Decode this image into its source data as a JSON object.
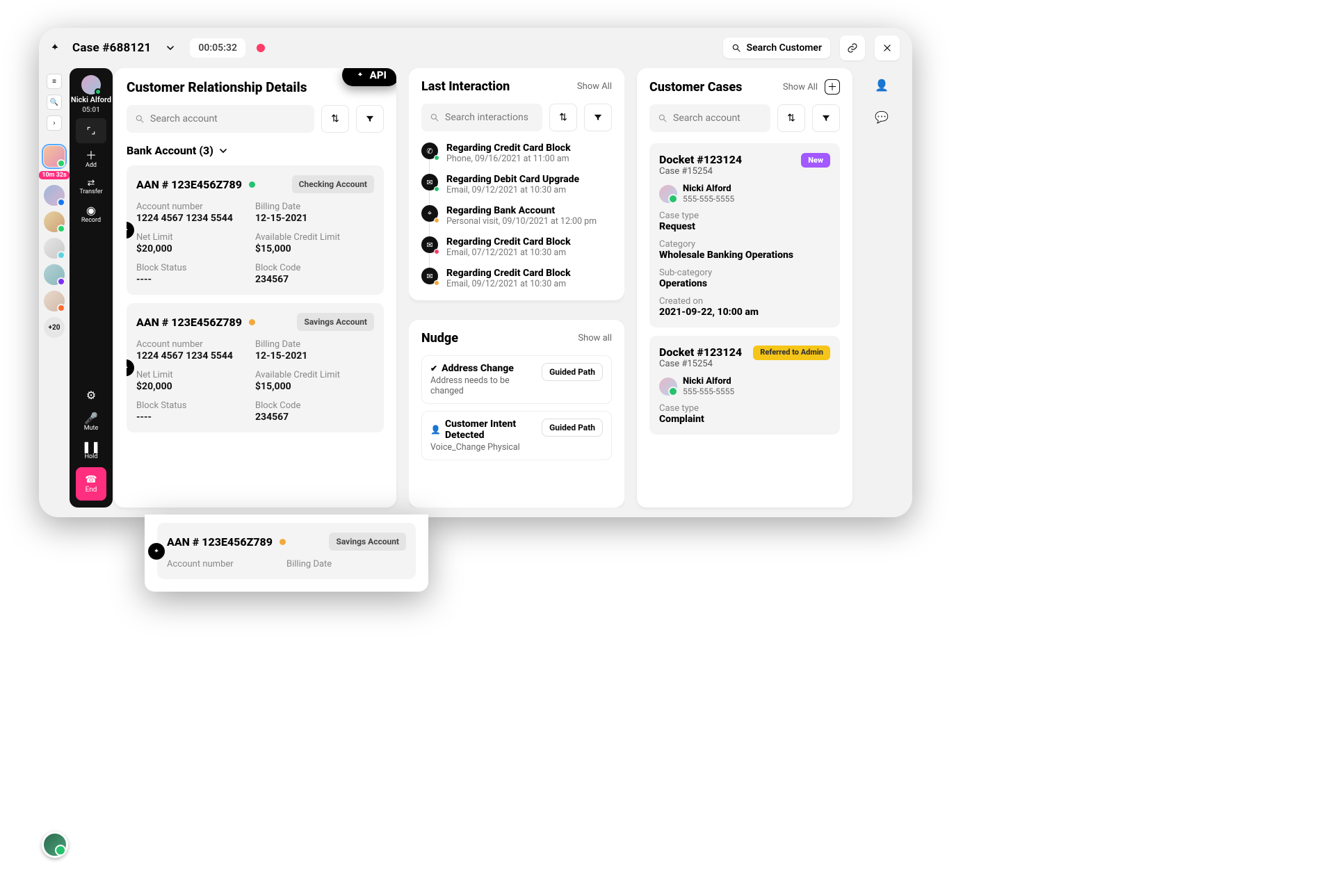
{
  "header": {
    "case_title": "Case #688121",
    "timer": "00:05:32",
    "search_label": "Search Customer"
  },
  "call_dock": {
    "name": "Nicki Alford",
    "timer": "05:01",
    "add": "Add",
    "transfer": "Transfer",
    "record": "Record",
    "mute": "Mute",
    "hold": "Hold",
    "end": "End"
  },
  "rail": {
    "active_label": "10m 32s",
    "more": "+20"
  },
  "crd": {
    "title": "Customer Relationship Details",
    "search_placeholder": "Search account",
    "api_label": "API",
    "section_title": "Bank Account (3)",
    "accounts": [
      {
        "aan": "AAN # 123E456Z789",
        "tag": "Checking Account",
        "status_color": "#25c26e",
        "account_number_label": "Account number",
        "account_number": "1224 4567 1234 5544",
        "billing_date_label": "Billing Date",
        "billing_date": "12-15-2021",
        "net_limit_label": "Net Limit",
        "net_limit": "$20,000",
        "avail_label": "Available Credit Limit",
        "avail": "$15,000",
        "block_status_label": "Block Status",
        "block_status": "----",
        "block_code_label": "Block Code",
        "block_code": "234567"
      },
      {
        "aan": "AAN # 123E456Z789",
        "tag": "Savings Account",
        "status_color": "#f2a93b",
        "account_number_label": "Account number",
        "account_number": "1224 4567 1234 5544",
        "billing_date_label": "Billing Date",
        "billing_date": "12-15-2021",
        "net_limit_label": "Net Limit",
        "net_limit": "$20,000",
        "avail_label": "Available Credit Limit",
        "avail": "$15,000",
        "block_status_label": "Block Status",
        "block_status": "----",
        "block_code_label": "Block Code",
        "block_code": "234567"
      },
      {
        "aan": "AAN # 123E456Z789",
        "tag": "Savings Account",
        "status_color": "#f2a93b",
        "account_number_label": "Account number",
        "account_number": "",
        "billing_date_label": "Billing Date",
        "billing_date": ""
      }
    ]
  },
  "interactions": {
    "title": "Last Interaction",
    "show_all": "Show All",
    "search_placeholder": "Search interactions",
    "items": [
      {
        "icon": "phone",
        "badge": "#25c26e",
        "title": "Regarding Credit Card Block",
        "sub": "Phone, 09/16/2021 at 11:00 am"
      },
      {
        "icon": "mail",
        "badge": "#25c26e",
        "title": "Regarding Debit Card Upgrade",
        "sub": "Email, 09/12/2021 at 10:30 am"
      },
      {
        "icon": "pin",
        "badge": "#f2a93b",
        "title": "Regarding Bank Account",
        "sub": "Personal visit, 09/10/2021 at 12:00 pm"
      },
      {
        "icon": "mail",
        "badge": "#ff3b6a",
        "title": "Regarding Credit Card Block",
        "sub": "Email, 07/12/2021 at 10:30 am"
      },
      {
        "icon": "mail",
        "badge": "#f2a93b",
        "title": "Regarding Credit Card Block",
        "sub": "Email, 09/12/2021 at 10:30 am"
      }
    ]
  },
  "nudge": {
    "title": "Nudge",
    "show_all": "Show all",
    "items": [
      {
        "icon": "check",
        "title": "Address Change",
        "desc": "Address needs to be changed",
        "btn": "Guided Path"
      },
      {
        "icon": "user",
        "title": "Customer Intent Detected",
        "desc": "Voice_Change Physical",
        "btn": "Guided Path"
      }
    ]
  },
  "cases": {
    "title": "Customer Cases",
    "show_all": "Show All",
    "search_placeholder": "Search account",
    "items": [
      {
        "docket": "Docket #123124",
        "case": "Case #15254",
        "badge": "New",
        "badge_class": "new",
        "assignee_name": "Nicki Alford",
        "assignee_phone": "555-555-5555",
        "fields": [
          {
            "label": "Case type",
            "value": "Request"
          },
          {
            "label": "Category",
            "value": "Wholesale Banking Operations"
          },
          {
            "label": "Sub-category",
            "value": "Operations"
          },
          {
            "label": "Created on",
            "value": "2021-09-22, 10:00 am"
          }
        ]
      },
      {
        "docket": "Docket #123124",
        "case": "Case #15254",
        "badge": "Referred to Admin",
        "badge_class": "ref",
        "assignee_name": "Nicki Alford",
        "assignee_phone": "555-555-5555",
        "fields": [
          {
            "label": "Case type",
            "value": "Complaint"
          }
        ]
      }
    ]
  }
}
